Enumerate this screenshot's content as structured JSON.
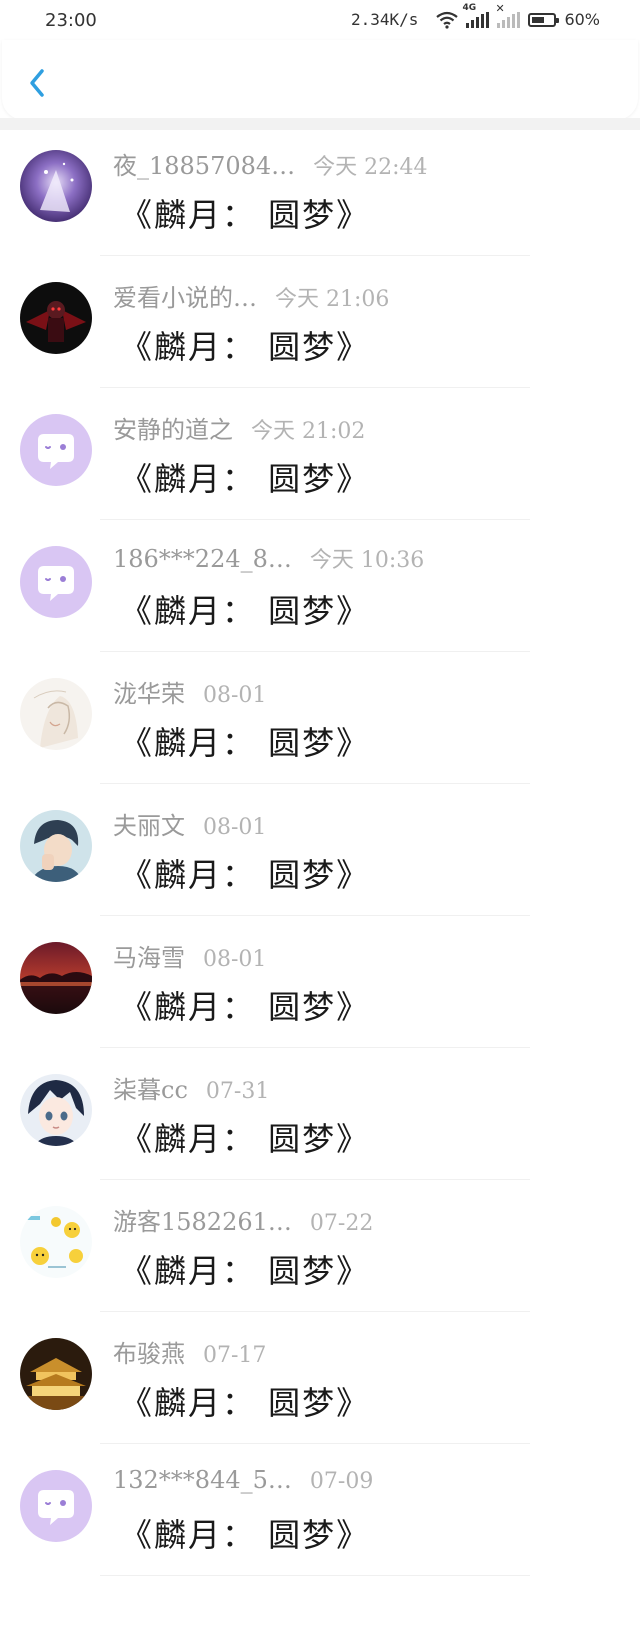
{
  "status_bar": {
    "time": "23:00",
    "network_speed": "2.34K/s",
    "network_type": "4G",
    "battery": "60%",
    "battery_level": 0.6
  },
  "header": {
    "back_icon": "chevron-left-icon"
  },
  "colors": {
    "accent": "#2f9fe0",
    "default_avatar_bg": "#d9c6f3",
    "username": "#9a9a9a",
    "time": "#b3b3b3",
    "title": "#1a1a1a"
  },
  "items": [
    {
      "username": "夜_18857084…",
      "time": "今天 22:44",
      "title": "《麟月： 圆梦》",
      "avatar": "galaxy-avatar"
    },
    {
      "username": "爱看小说的…",
      "time": "今天 21:06",
      "title": "《麟月： 圆梦》",
      "avatar": "dark-character-avatar"
    },
    {
      "username": "安静的道之",
      "time": "今天 21:02",
      "title": "《麟月： 圆梦》",
      "avatar": "default-chat-avatar"
    },
    {
      "username": "186***224_8…",
      "time": "今天 10:36",
      "title": "《麟月： 圆梦》",
      "avatar": "default-chat-avatar"
    },
    {
      "username": "泷华荣",
      "time": "08-01",
      "title": "《麟月： 圆梦》",
      "avatar": "sketch-avatar"
    },
    {
      "username": "夫丽文",
      "time": "08-01",
      "title": "《麟月： 圆梦》",
      "avatar": "boy-avatar"
    },
    {
      "username": "马海雪",
      "time": "08-01",
      "title": "《麟月： 圆梦》",
      "avatar": "sunset-avatar"
    },
    {
      "username": "柒暮cc",
      "time": "07-31",
      "title": "《麟月： 圆梦》",
      "avatar": "anime-avatar"
    },
    {
      "username": "游客1582261…",
      "time": "07-22",
      "title": "《麟月： 圆梦》",
      "avatar": "pikachu-avatar"
    },
    {
      "username": "布骏燕",
      "time": "07-17",
      "title": "《麟月： 圆梦》",
      "avatar": "palace-avatar"
    },
    {
      "username": "132***844_5…",
      "time": "07-09",
      "title": "《麟月： 圆梦》",
      "avatar": "default-chat-avatar"
    }
  ]
}
